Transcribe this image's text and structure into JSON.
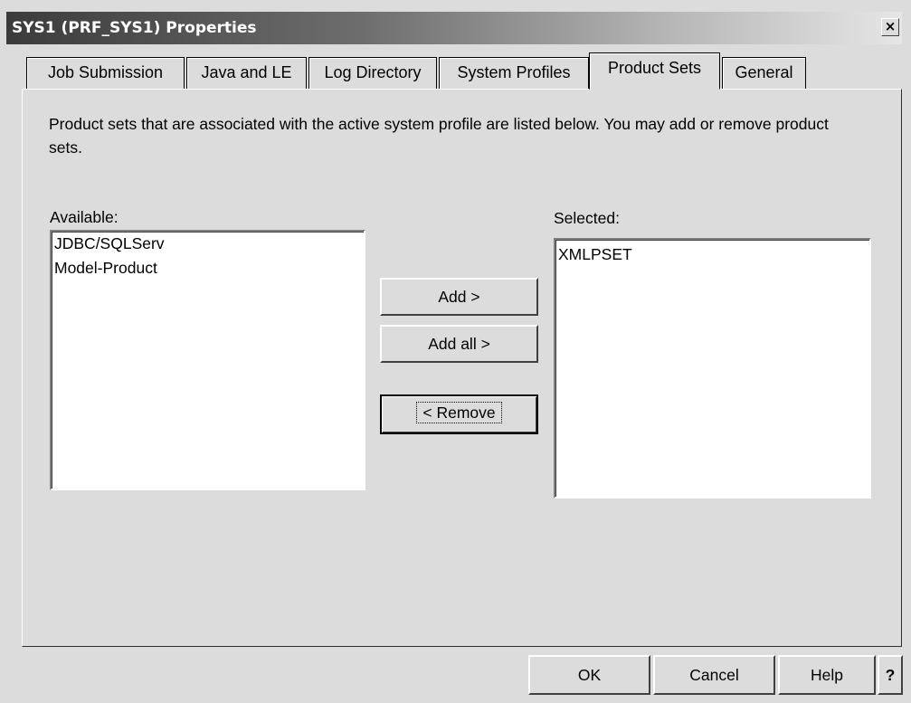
{
  "window": {
    "title": "SYS1 (PRF_SYS1) Properties",
    "close_glyph": "✕"
  },
  "tabs": [
    {
      "label": "Job Submission"
    },
    {
      "label": "Java and LE"
    },
    {
      "label": "Log Directory"
    },
    {
      "label": "System Profiles"
    },
    {
      "label": "Product Sets",
      "active": true
    },
    {
      "label": "General"
    }
  ],
  "panel": {
    "description": "Product sets that are associated with the active system profile are listed below. You may add or remove product sets.",
    "available_label": "Available:",
    "selected_label": "Selected:",
    "available_items": [
      "JDBC/SQLServ",
      "Model-Product"
    ],
    "selected_items": [
      "XMLPSET"
    ],
    "add_label": "Add >",
    "add_all_label": "Add all >",
    "remove_label": "< Remove"
  },
  "footer": {
    "ok_label": "OK",
    "cancel_label": "Cancel",
    "help_label": "Help",
    "context_help_label": "?"
  }
}
